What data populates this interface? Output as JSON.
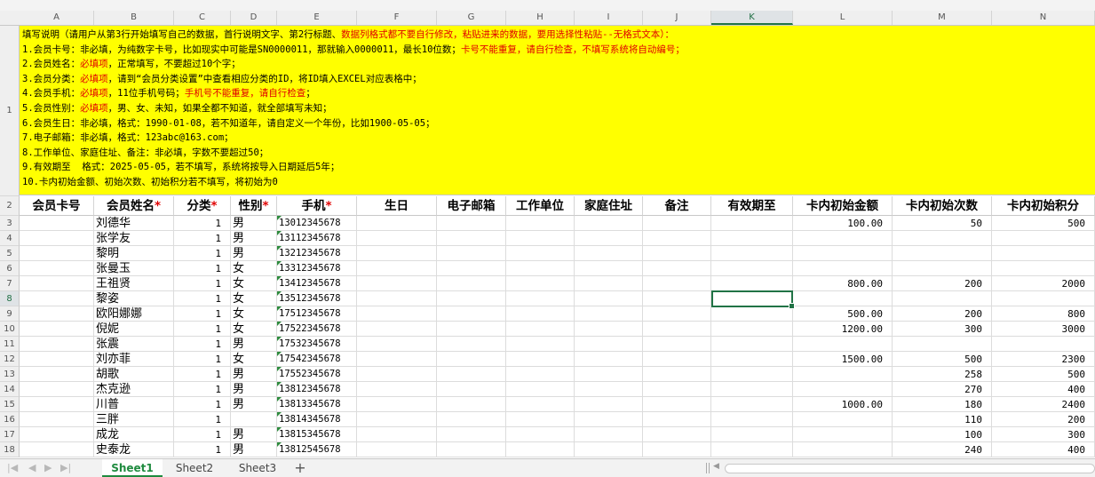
{
  "columns": [
    "A",
    "B",
    "C",
    "D",
    "E",
    "F",
    "G",
    "H",
    "I",
    "J",
    "K",
    "L",
    "M",
    "N"
  ],
  "row_numbers": [
    "1",
    "2",
    "3",
    "4",
    "5",
    "6",
    "7",
    "8",
    "9",
    "10",
    "11",
    "12",
    "13",
    "14",
    "15",
    "16",
    "17",
    "18"
  ],
  "instructions": {
    "line0": {
      "a": "填写说明（请用户从第3行开始填写自己的数据，首行说明文字、第2行标题、",
      "b": "数据列格式都不要自行修改，粘贴进来的数据，要用选择性粘贴--无格式文本）：",
      "c": ""
    },
    "line1": {
      "a": "1.会员卡号：非必填，为纯数字卡号，比如现实中可能是SN0000011，那就输入0000011，最长10位数；",
      "b": "卡号不能重复，请自行检查，不填写系统将自动编号；",
      "c": ""
    },
    "line2": {
      "a": "2.会员姓名：",
      "b": "必填项",
      "c": "，正常填写，不要超过10个字；"
    },
    "line3": {
      "a": "3.会员分类：",
      "b": "必填项",
      "c": "，请到“会员分类设置”中查看相应分类的ID，将ID填入EXCEL对应表格中；"
    },
    "line4": {
      "a": "4.会员手机：",
      "b": "必填项",
      "c": "，11位手机号码；",
      "d": "手机号不能重复，请自行检查",
      "e": "；"
    },
    "line5": {
      "a": "5.会员性别：",
      "b": "必填项",
      "c": "，男、女、未知，如果全都不知道，就全部填写未知；"
    },
    "line6": "6.会员生日：非必填，格式：1990-01-08，若不知道年，请自定义一个年份，比如1900-05-05；",
    "line7": "7.电子邮箱：非必填，格式：123abc@163.com；",
    "line8": "8.工作单位、家庭住址、备注：非必填，字数不要超过50；",
    "line9": "9.有效期至  格式：2025-05-05，若不填写，系统将按导入日期延后5年；",
    "line10": "10.卡内初始金额、初始次数、初始积分若不填写，将初始为0"
  },
  "headers": {
    "card_no": "会员卡号",
    "name": "会员姓名",
    "category": "分类",
    "gender": "性别",
    "phone": "手机",
    "birthday": "生日",
    "email": "电子邮箱",
    "work_unit": "工作单位",
    "home_address": "家庭住址",
    "remark": "备注",
    "valid_until": "有效期至",
    "init_amount": "卡内初始金额",
    "init_count": "卡内初始次数",
    "init_points": "卡内初始积分",
    "required_mark": "*"
  },
  "rows": [
    {
      "name": "刘德华",
      "category": "1",
      "gender": "男",
      "phone": "13012345678",
      "amount": "100.00",
      "count": "50",
      "points": "500"
    },
    {
      "name": "张学友",
      "category": "1",
      "gender": "男",
      "phone": "13112345678",
      "amount": "",
      "count": "",
      "points": ""
    },
    {
      "name": "黎明",
      "category": "1",
      "gender": "男",
      "phone": "13212345678",
      "amount": "",
      "count": "",
      "points": ""
    },
    {
      "name": "张曼玉",
      "category": "1",
      "gender": "女",
      "phone": "13312345678",
      "amount": "",
      "count": "",
      "points": ""
    },
    {
      "name": "王祖贤",
      "category": "1",
      "gender": "女",
      "phone": "13412345678",
      "amount": "800.00",
      "count": "200",
      "points": "2000"
    },
    {
      "name": "黎姿",
      "category": "1",
      "gender": "女",
      "phone": "13512345678",
      "amount": "",
      "count": "",
      "points": ""
    },
    {
      "name": "欧阳娜娜",
      "category": "1",
      "gender": "女",
      "phone": "17512345678",
      "amount": "500.00",
      "count": "200",
      "points": "800"
    },
    {
      "name": "倪妮",
      "category": "1",
      "gender": "女",
      "phone": "17522345678",
      "amount": "1200.00",
      "count": "300",
      "points": "3000"
    },
    {
      "name": "张震",
      "category": "1",
      "gender": "男",
      "phone": "17532345678",
      "amount": "",
      "count": "",
      "points": ""
    },
    {
      "name": "刘亦菲",
      "category": "1",
      "gender": "女",
      "phone": "17542345678",
      "amount": "1500.00",
      "count": "500",
      "points": "2300"
    },
    {
      "name": "胡歌",
      "category": "1",
      "gender": "男",
      "phone": "17552345678",
      "amount": "",
      "count": "258",
      "points": "500"
    },
    {
      "name": "杰克逊",
      "category": "1",
      "gender": "男",
      "phone": "13812345678",
      "amount": "",
      "count": "270",
      "points": "400"
    },
    {
      "name": "川普",
      "category": "1",
      "gender": "男",
      "phone": "13813345678",
      "amount": "1000.00",
      "count": "180",
      "points": "2400"
    },
    {
      "name": "三胖",
      "category": "1",
      "gender": "",
      "phone": "13814345678",
      "amount": "",
      "count": "110",
      "points": "200"
    },
    {
      "name": "成龙",
      "category": "1",
      "gender": "男",
      "phone": "13815345678",
      "amount": "",
      "count": "100",
      "points": "300"
    },
    {
      "name": "史泰龙",
      "category": "1",
      "gender": "男",
      "phone": "13812545678",
      "amount": "",
      "count": "240",
      "points": "400"
    }
  ],
  "sheets": [
    "Sheet1",
    "Sheet2",
    "Sheet3"
  ],
  "add_sheet_label": "+",
  "nav_labels": {
    "first": "|◀",
    "prev": "◀",
    "next": "▶",
    "last": "▶|"
  },
  "accent_color": "#217346"
}
